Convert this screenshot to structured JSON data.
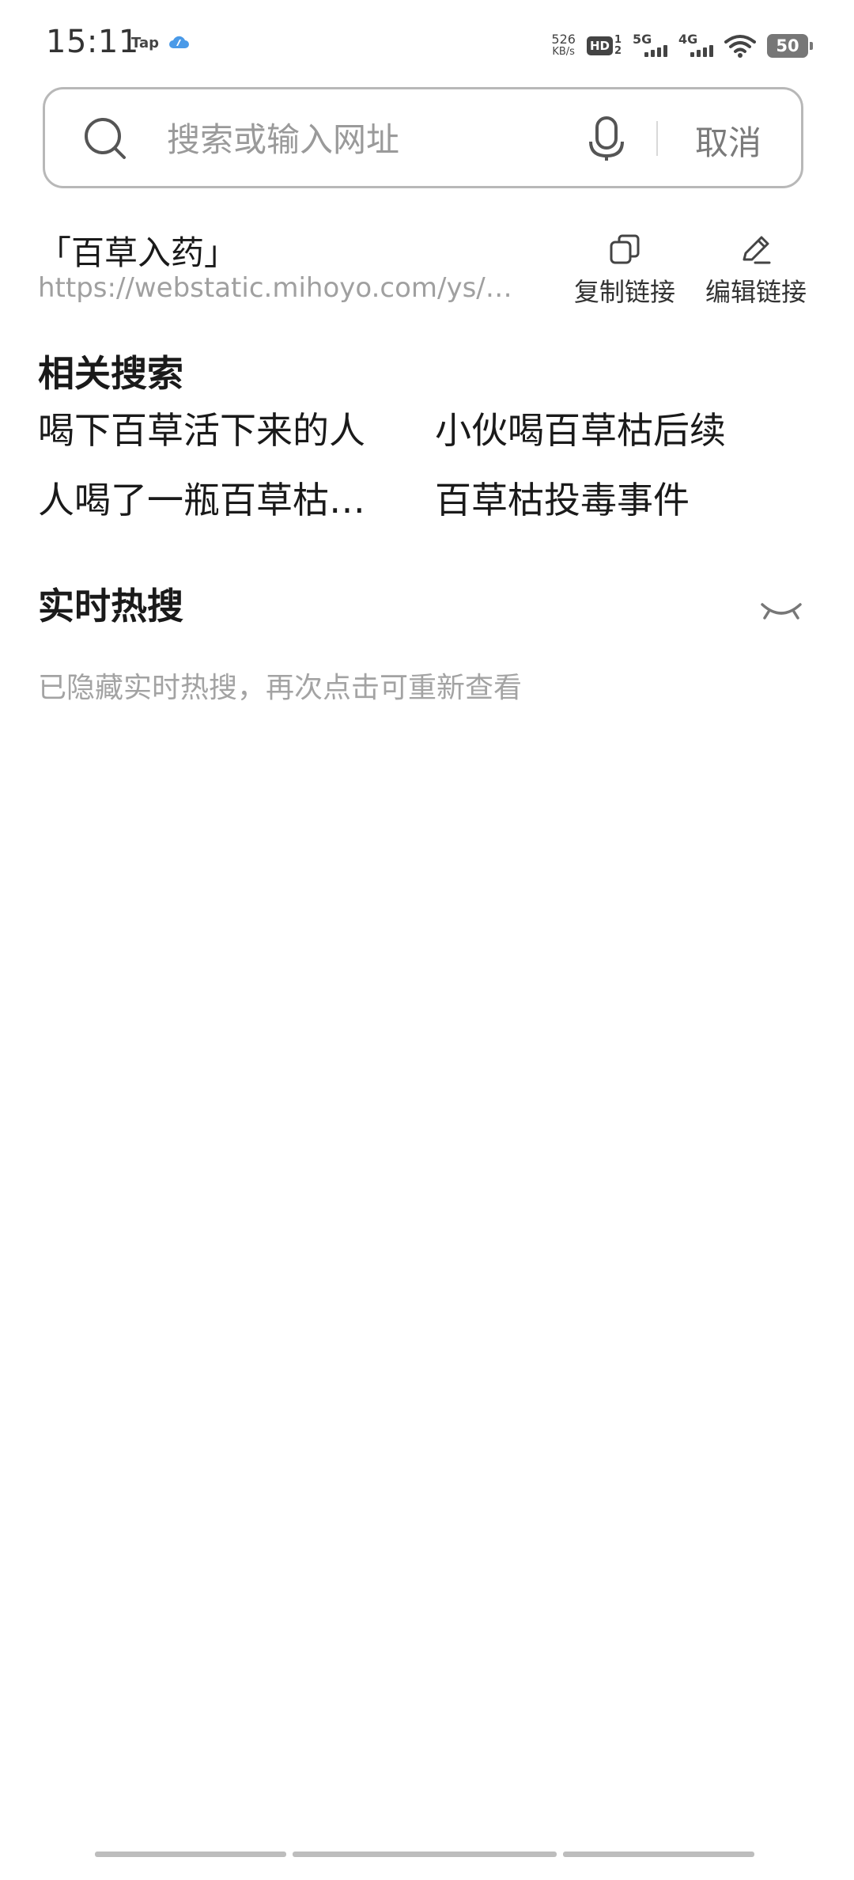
{
  "status_bar": {
    "time": "15:11",
    "tap_label": "Tap",
    "speed_value": "526",
    "speed_unit": "KB/s",
    "hd_label": "HD",
    "hd_sub_top": "1",
    "hd_sub_bottom": "2",
    "signal_1": "5G",
    "signal_2": "4G",
    "battery": "50"
  },
  "search": {
    "placeholder": "搜索或输入网址",
    "value": "",
    "cancel_label": "取消"
  },
  "current_page": {
    "title": "「百草入药」",
    "url": "https://webstatic.mihoyo.com/ys/…",
    "copy_link_label": "复制链接",
    "edit_link_label": "编辑链接"
  },
  "related": {
    "heading": "相关搜索",
    "items": [
      "喝下百草活下来的人",
      "小伙喝百草枯后续",
      "人喝了一瓶百草枯…",
      "百草枯投毒事件"
    ]
  },
  "hot_search": {
    "heading": "实时热搜",
    "hidden_note": "已隐藏实时热搜，再次点击可重新查看"
  }
}
